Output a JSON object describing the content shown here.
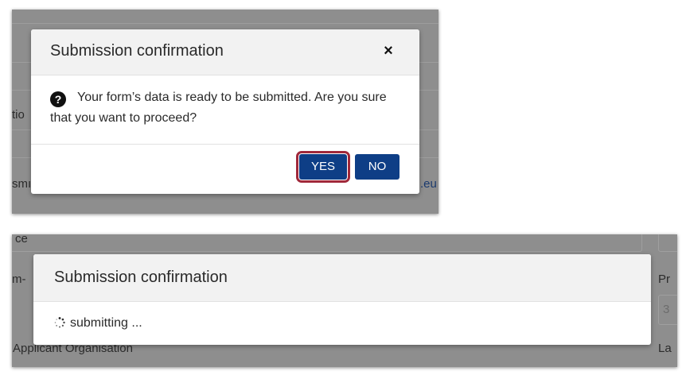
{
  "top_dialog": {
    "title": "Submission confirmation",
    "close_glyph": "×",
    "help_icon_glyph": "?",
    "message": "Your form’s data is ready to be submitted. Are you sure that you want to proceed?",
    "yes_label": "YES",
    "no_label": "NO",
    "highlight_color": "#a0283a",
    "button_color": "#0e3e86"
  },
  "top_background": {
    "fragment_1": "tio",
    "fragment_2": "smı",
    "fragment_3": ".eu"
  },
  "bottom_dialog": {
    "title": "Submission confirmation",
    "status_text": "submitting ..."
  },
  "bottom_background": {
    "fragment_top": "ce",
    "fragment_left": "m-",
    "fragment_right_1": "Pr",
    "fragment_right_2": "3",
    "fragment_right_3": "La",
    "applicant_label": "Applicant Organisation"
  }
}
